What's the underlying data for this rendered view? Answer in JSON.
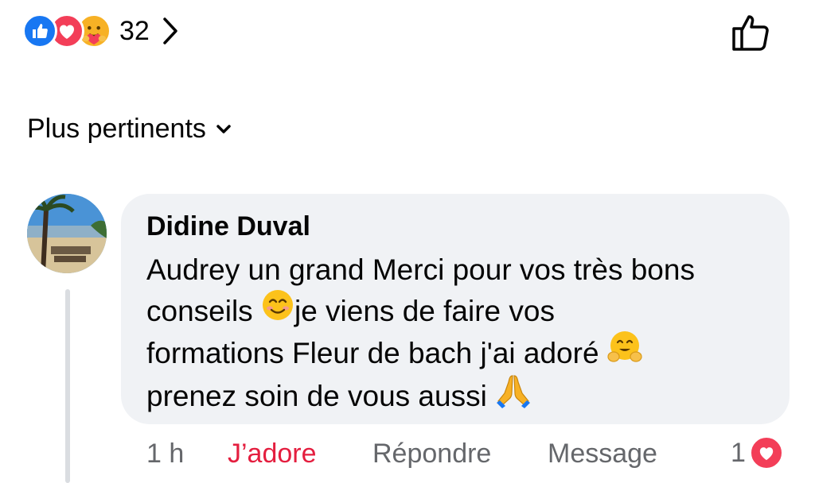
{
  "reactions": {
    "types": [
      "like-icon",
      "love-icon",
      "care-icon"
    ],
    "count": "32",
    "colors": {
      "like": "#1877f2",
      "love": "#f33e58",
      "care": "#f7b125"
    }
  },
  "sort": {
    "label": "Plus pertinents"
  },
  "comment": {
    "author": "Didine Duval",
    "lines": [
      "Audrey un grand Merci pour vos très bons",
      "conseils",
      "je viens de faire vos",
      "formations Fleur de bach j'ai adoré",
      "prenez soin de vous aussi"
    ],
    "emojis": [
      "smiling-face-icon",
      "hugging-face-icon",
      "folded-hands-icon"
    ],
    "time": "1 h",
    "reaction_label": "J’adore",
    "reply_label": "Répondre",
    "message_label": "Message",
    "reaction_count": "1"
  },
  "theme": {
    "accent": "#e41e3f",
    "muted": "#65676b",
    "bubble": "#f0f2f5"
  }
}
